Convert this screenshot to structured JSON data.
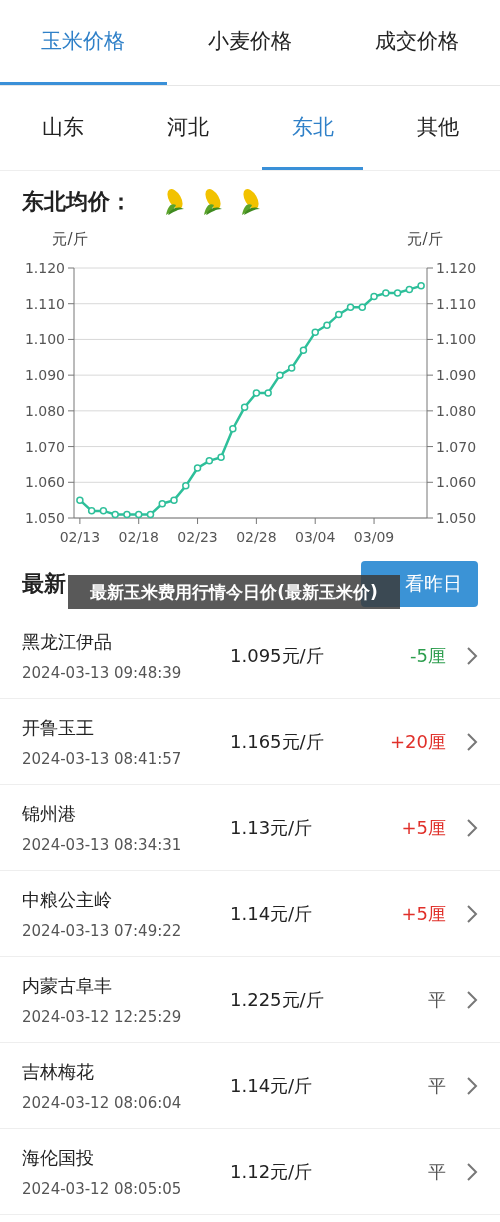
{
  "top_tabs": [
    {
      "label": "玉米价格",
      "selected": true
    },
    {
      "label": "小麦价格",
      "selected": false
    },
    {
      "label": "成交价格",
      "selected": false
    }
  ],
  "region_tabs": [
    {
      "label": "山东",
      "selected": false
    },
    {
      "label": "河北",
      "selected": false
    },
    {
      "label": "东北",
      "selected": true
    },
    {
      "label": "其他",
      "selected": false
    }
  ],
  "average": {
    "title": "东北均价：",
    "chart_data": {
      "type": "line",
      "ylabel": "元/斤",
      "grid": true,
      "categories": [
        "02/13",
        null,
        null,
        null,
        null,
        "02/18",
        null,
        null,
        null,
        null,
        "02/23",
        null,
        null,
        null,
        null,
        "02/28",
        null,
        null,
        null,
        null,
        "03/04",
        null,
        null,
        null,
        null,
        "03/09",
        null,
        null,
        null,
        null
      ],
      "series": [
        {
          "color": "#2ebf9a",
          "marker": "circle",
          "values": [
            1.055,
            1.052,
            1.052,
            1.051,
            1.051,
            1.051,
            1.051,
            1.054,
            1.055,
            1.059,
            1.064,
            1.066,
            1.067,
            1.075,
            1.081,
            1.085,
            1.085,
            1.09,
            1.092,
            1.097,
            1.102,
            1.104,
            1.107,
            1.109,
            1.109,
            1.112,
            1.113,
            1.113,
            1.114,
            1.115
          ]
        }
      ],
      "ylim": [
        1.05,
        1.12
      ],
      "yticks": [
        {
          "value": 1.05,
          "label": "1.050"
        },
        {
          "value": 1.06,
          "label": "1.060"
        },
        {
          "value": 1.07,
          "label": "1.070"
        },
        {
          "value": 1.08,
          "label": "1.080"
        },
        {
          "value": 1.09,
          "label": "1.090"
        },
        {
          "value": 1.1,
          "label": "1.100"
        },
        {
          "value": 1.11,
          "label": "1.110"
        },
        {
          "value": 1.12,
          "label": "1.120"
        }
      ]
    }
  },
  "latest": {
    "title": "最新",
    "button": "看昨日",
    "rows": [
      {
        "name": "黑龙江伊品",
        "time": "2024-03-13 09:48:39",
        "price": "1.095元/斤",
        "change": "-5厘",
        "color": "#2e9e4f"
      },
      {
        "name": "开鲁玉王",
        "time": "2024-03-13 08:41:57",
        "price": "1.165元/斤",
        "change": "+20厘",
        "color": "#e0302a"
      },
      {
        "name": "锦州港",
        "time": "2024-03-13 08:34:31",
        "price": "1.13元/斤",
        "change": "+5厘",
        "color": "#e0302a"
      },
      {
        "name": "中粮公主岭",
        "time": "2024-03-13 07:49:22",
        "price": "1.14元/斤",
        "change": "+5厘",
        "color": "#e0302a"
      },
      {
        "name": "内蒙古阜丰",
        "time": "2024-03-12 12:25:29",
        "price": "1.225元/斤",
        "change": "平",
        "color": "#555555"
      },
      {
        "name": "吉林梅花",
        "time": "2024-03-12 08:06:04",
        "price": "1.14元/斤",
        "change": "平",
        "color": "#555555"
      },
      {
        "name": "海伦国投",
        "time": "2024-03-12 08:05:05",
        "price": "1.12元/斤",
        "change": "平",
        "color": "#555555"
      }
    ]
  },
  "banner": {
    "text": "最新玉米费用行情今日价(最新玉米价)"
  }
}
